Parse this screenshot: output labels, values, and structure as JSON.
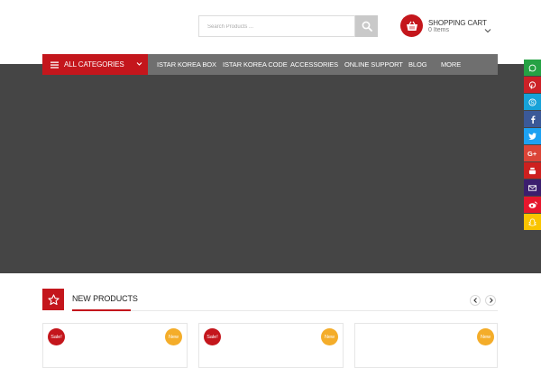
{
  "header": {
    "search_placeholder": "Search Products ...",
    "cart_title": "SHOPPING CART",
    "cart_items": "0 Items"
  },
  "nav": {
    "all_categories": "ALL CATEGORIES",
    "items": [
      "ISTAR KOREA BOX",
      "ISTAR KOREA CODE",
      "ACCESSORIES",
      "ONLINE SUPPORT",
      "BLOG",
      "MORE"
    ]
  },
  "social": [
    {
      "name": "whatsapp-icon",
      "color": "#25a244"
    },
    {
      "name": "pinterest-icon",
      "color": "#cc2127"
    },
    {
      "name": "skype-icon",
      "color": "#16a2d8"
    },
    {
      "name": "facebook-icon",
      "color": "#3b5998"
    },
    {
      "name": "twitter-icon",
      "color": "#1da1f2"
    },
    {
      "name": "google-plus-icon",
      "color": "#db4437"
    },
    {
      "name": "youtube-icon",
      "color": "#cd201f"
    },
    {
      "name": "email-icon",
      "color": "#3c1e6e"
    },
    {
      "name": "weibo-icon",
      "color": "#e6162d"
    },
    {
      "name": "snapchat-icon",
      "color": "#f9c400"
    }
  ],
  "new_products": {
    "title": "NEW PRODUCTS",
    "cards": [
      {
        "sale": "Sale!",
        "new": "New"
      },
      {
        "sale": "Sale!",
        "new": "New"
      },
      {
        "new": "New"
      }
    ]
  },
  "colors": {
    "accent": "#c4161c",
    "nav_bg": "#6f6f6f",
    "hero_bg": "#454545",
    "new_badge": "#f4ad2a"
  }
}
